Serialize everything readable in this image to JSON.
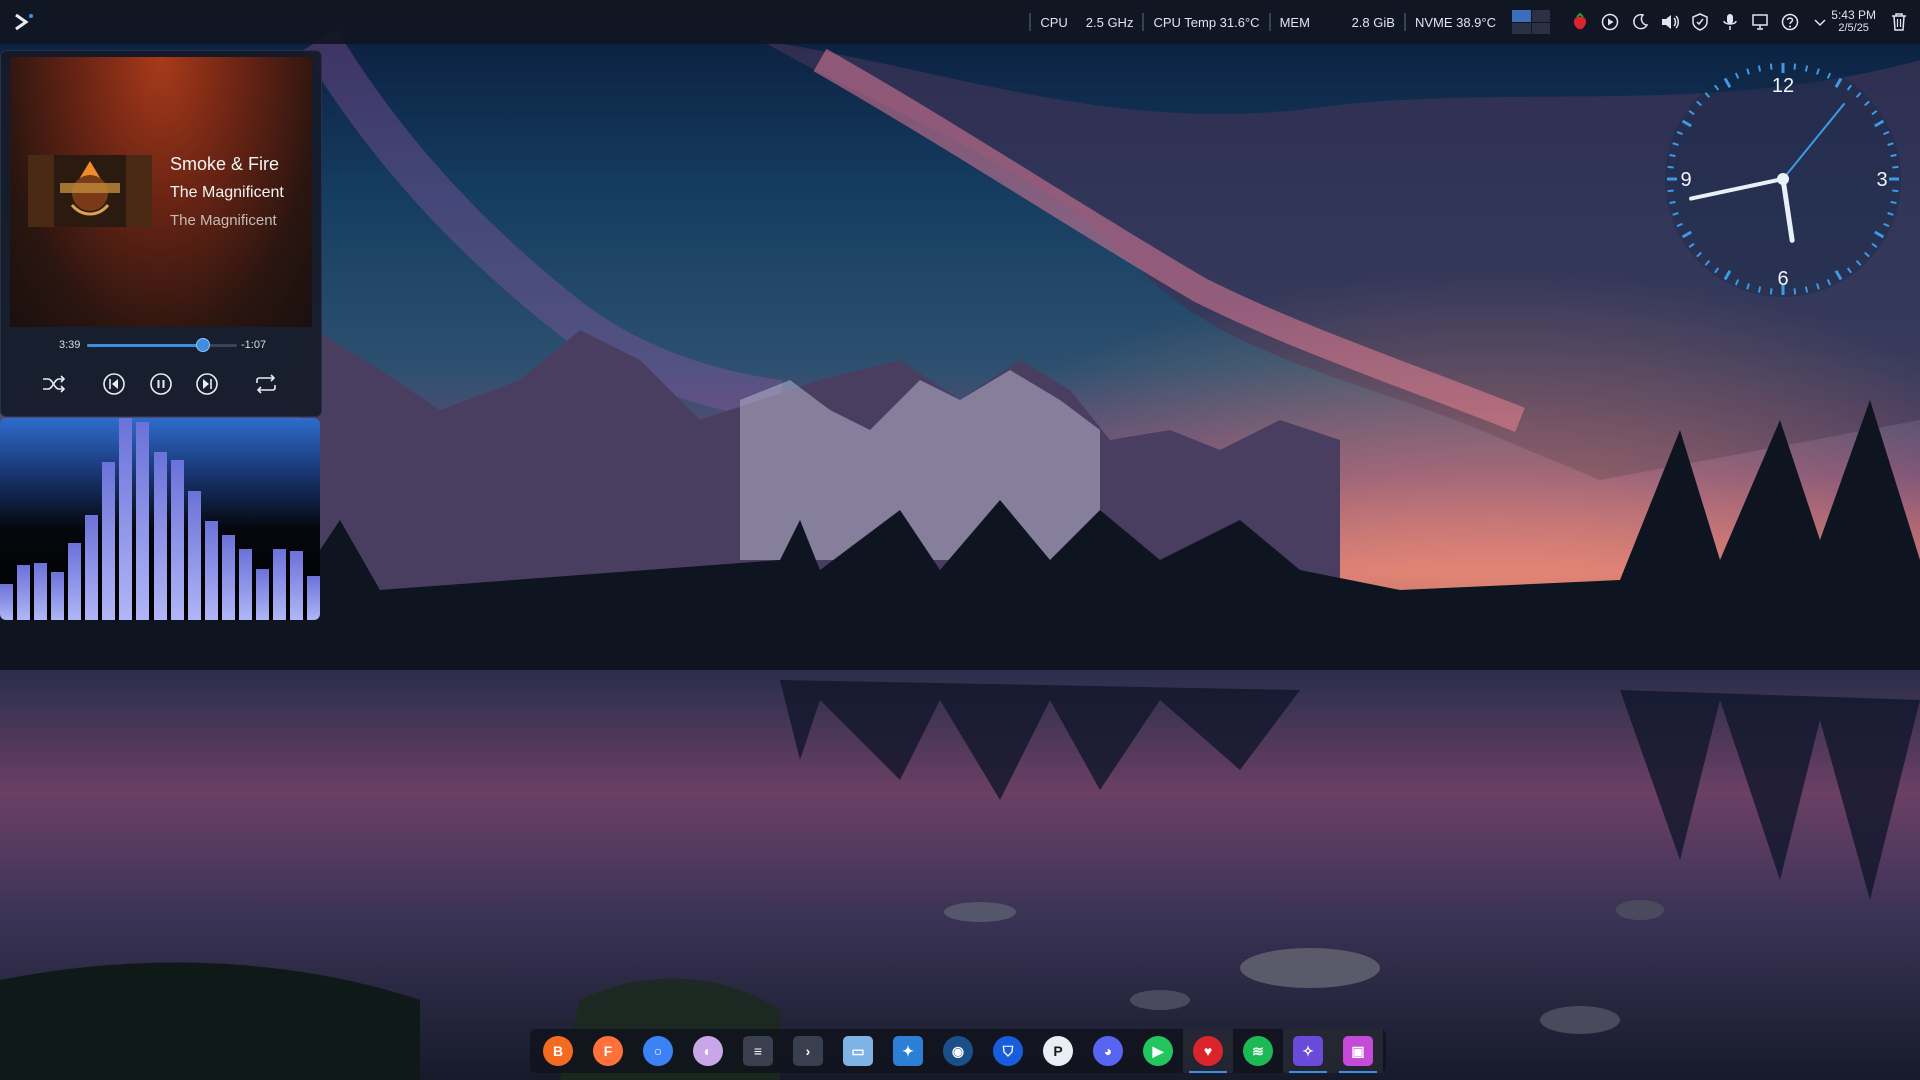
{
  "panel": {
    "sysmon": [
      {
        "id": "cpu-label",
        "text": "CPU"
      },
      {
        "id": "cpu-freq",
        "text": "2.5 GHz"
      },
      {
        "id": "cpu-temp",
        "text": "CPU Temp 31.6°C"
      },
      {
        "id": "mem-label",
        "text": "MEM"
      },
      {
        "id": "mem-used",
        "text": "2.8 GiB"
      },
      {
        "id": "nvme-temp",
        "text": "NVME 38.9°C"
      }
    ],
    "clock": {
      "time": "5:43 PM",
      "date": "2/5/25"
    },
    "tray_icons": [
      "pager",
      "strawberry-icon",
      "media-play-icon",
      "night-mode-icon",
      "volume-icon",
      "vpn-icon",
      "microphone-icon",
      "display-icon",
      "help-icon",
      "chevron-down-icon"
    ]
  },
  "player": {
    "title": "Smoke & Fire",
    "artist": "The Magnificent",
    "album": "The Magnificent",
    "elapsed": "3:39",
    "remaining": "-1:07",
    "progress": 0.77,
    "controls": [
      "shuffle-icon",
      "previous-icon",
      "pause-icon",
      "next-icon",
      "repeat-icon"
    ],
    "accent": "#3d8ee0"
  },
  "visualizer": {
    "levels": [
      0.18,
      0.27,
      0.28,
      0.24,
      0.38,
      0.52,
      0.78,
      1.0,
      0.98,
      0.83,
      0.79,
      0.64,
      0.49,
      0.42,
      0.35,
      0.25,
      0.35,
      0.34,
      0.22
    ]
  },
  "analog_clock": {
    "numerals": [
      "12",
      "3",
      "6",
      "9"
    ],
    "hours": 5,
    "minutes": 43
  },
  "dock": {
    "apps": [
      {
        "name": "brave",
        "icon": "brave-icon",
        "color": "#f26b21",
        "glyph": "B"
      },
      {
        "name": "firefox",
        "icon": "firefox-icon",
        "color": "#ff7139",
        "glyph": "F"
      },
      {
        "name": "chromium",
        "icon": "chromium-icon",
        "color": "#3b82f6",
        "glyph": "○"
      },
      {
        "name": "gpt",
        "icon": "ai-app-icon",
        "color": "#c9a6e8",
        "glyph": "◐"
      },
      {
        "name": "settings",
        "icon": "settings-sliders-icon",
        "color": "#3a3f50",
        "glyph": "≡"
      },
      {
        "name": "terminal",
        "icon": "terminal-icon",
        "color": "#3a3f50",
        "glyph": "›"
      },
      {
        "name": "files",
        "icon": "folder-icon",
        "color": "#7fb3e6",
        "glyph": "▭"
      },
      {
        "name": "flatpak",
        "icon": "app-store-icon",
        "color": "#2d7fd6",
        "glyph": "✦"
      },
      {
        "name": "steam",
        "icon": "steam-icon",
        "color": "#1b4f8a",
        "glyph": "◉"
      },
      {
        "name": "bitwarden",
        "icon": "shield-icon",
        "color": "#175ddc",
        "glyph": "⛉"
      },
      {
        "name": "pupgui",
        "icon": "pupgui-icon",
        "color": "#e8eef4",
        "glyph": "P"
      },
      {
        "name": "discord",
        "icon": "discord-icon",
        "color": "#5865f2",
        "glyph": "◕"
      },
      {
        "name": "play",
        "icon": "play-store-icon",
        "color": "#22c55e",
        "glyph": "▶"
      },
      {
        "name": "strawberry",
        "icon": "strawberry-icon",
        "color": "#d9252b",
        "glyph": "♥"
      },
      {
        "name": "spotify",
        "icon": "spotify-icon",
        "color": "#1db954",
        "glyph": "≋"
      },
      {
        "name": "space",
        "icon": "space-icon",
        "color": "#6a4ad8",
        "glyph": "✧"
      },
      {
        "name": "screenshot",
        "icon": "screenshot-icon",
        "color": "#c44ad8",
        "glyph": "▣"
      }
    ],
    "active": [
      "strawberry",
      "space",
      "screenshot"
    ]
  }
}
